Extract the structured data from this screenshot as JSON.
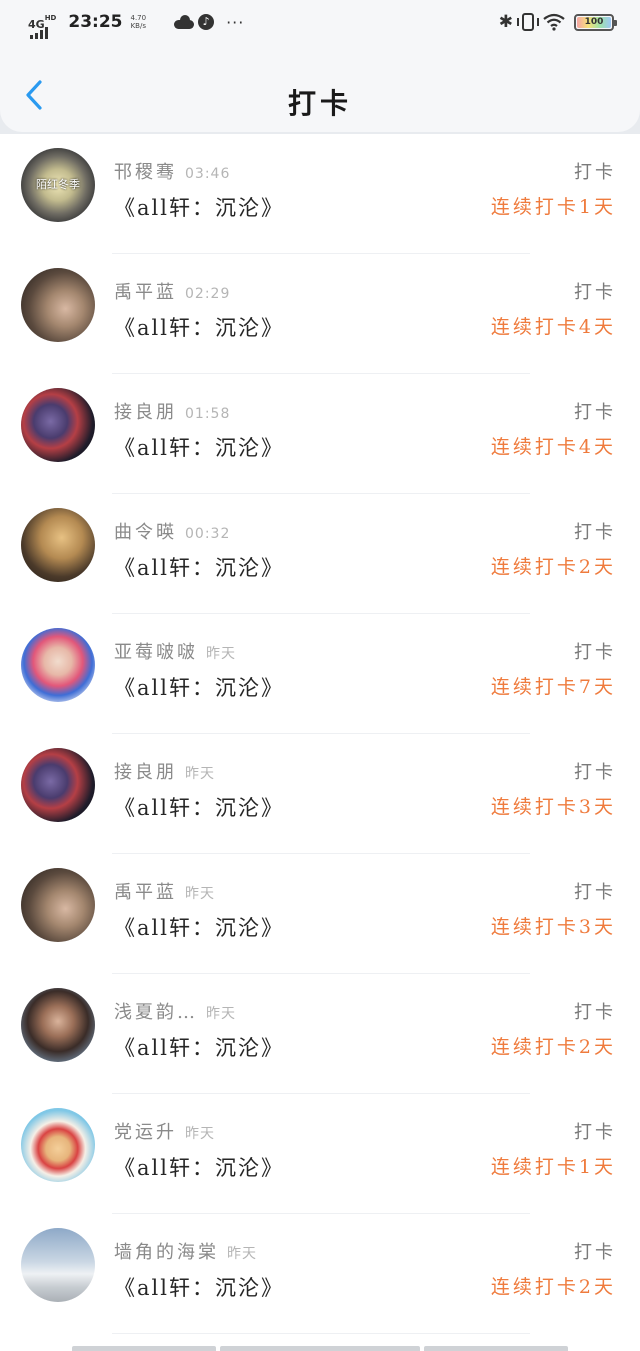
{
  "status_bar": {
    "network": "4G",
    "network_hd": "HD",
    "time": "23:25",
    "speed_value": "4.70",
    "speed_unit": "KB/s",
    "dots": "···",
    "battery": "100"
  },
  "header": {
    "title": "打卡"
  },
  "colors": {
    "streak": "#ef7b3d",
    "back_icon": "#2a9af0"
  },
  "entries": [
    {
      "name": "邗稷骞",
      "time": "03:46",
      "book": "《all轩：沉沦》",
      "action": "打卡",
      "streak": "连续打卡1天",
      "avatar": {
        "bg": "radial-gradient(circle at 50% 50%, #efe7b8 0%, #c2bb8e 30%, #6f6c63 55%, #2c2d30 80%)",
        "caption": "陌红冬季"
      }
    },
    {
      "name": "禹平蓝",
      "time": "02:29",
      "book": "《all轩：沉沦》",
      "action": "打卡",
      "streak": "连续打卡4天",
      "avatar": {
        "bg": "radial-gradient(circle at 60% 55%, #d8b8a3 0%, #a4876f 30%, #5b4a3e 60%, #2e2621 90%)",
        "caption": ""
      }
    },
    {
      "name": "接良朋",
      "time": "01:58",
      "book": "《all轩：沉沦》",
      "action": "打卡",
      "streak": "连续打卡4天",
      "avatar": {
        "bg": "radial-gradient(circle at 40% 45%, #7a6aa5 0%, #4a3c6e 28%, #b53f45 45%, #1f1c2a 70%, #0e0d14 90%)",
        "caption": ""
      }
    },
    {
      "name": "曲令暎",
      "time": "00:32",
      "book": "《all轩：沉沦》",
      "action": "打卡",
      "streak": "连续打卡2天",
      "avatar": {
        "bg": "radial-gradient(circle at 55% 40%, #e7c183 0%, #b48a52 35%, #4b3a2a 65%, #2a221b 90%)",
        "caption": ""
      }
    },
    {
      "name": "亚莓啵啵",
      "time": "昨天",
      "book": "《all轩：沉沦》",
      "action": "打卡",
      "streak": "连续打卡7天",
      "avatar": {
        "bg": "radial-gradient(circle at 50% 45%, #f1dccd 0%, #e7b8a8 25%, #e2577a 45%, #3e6dd6 62%, #f4f4f6 85%)",
        "caption": ""
      }
    },
    {
      "name": "接良朋",
      "time": "昨天",
      "book": "《all轩：沉沦》",
      "action": "打卡",
      "streak": "连续打卡3天",
      "avatar": {
        "bg": "radial-gradient(circle at 40% 45%, #7a6aa5 0%, #4a3c6e 28%, #b53f45 45%, #1f1c2a 70%, #0e0d14 90%)",
        "caption": ""
      }
    },
    {
      "name": "禹平蓝",
      "time": "昨天",
      "book": "《all轩：沉沦》",
      "action": "打卡",
      "streak": "连续打卡3天",
      "avatar": {
        "bg": "radial-gradient(circle at 60% 55%, #d8b8a3 0%, #a4876f 30%, #5b4a3e 60%, #2e2621 90%)",
        "caption": ""
      }
    },
    {
      "name": "浅夏韵…",
      "time": "昨天",
      "book": "《all轩：沉沦》",
      "action": "打卡",
      "streak": "连续打卡2天",
      "avatar": {
        "bg": "radial-gradient(circle at 50% 45%, #d9b39b 0%, #9b6f58 28%, #3a2c28 55%, #6b7e92 80%, #9fb0c0 95%)",
        "caption": ""
      }
    },
    {
      "name": "党运升",
      "time": "昨天",
      "book": "《all轩：沉沦》",
      "action": "打卡",
      "streak": "连续打卡1天",
      "avatar": {
        "bg": "radial-gradient(circle at 50% 55%, #f4cf9a 0%, #e7b57c 22%, #d94343 36%, #f6efe6 50%, #7fc7e6 70%, #8fd0ec 95%)",
        "caption": ""
      }
    },
    {
      "name": "墙角的海棠",
      "time": "昨天",
      "book": "《all轩：沉沦》",
      "action": "打卡",
      "streak": "连续打卡2天",
      "avatar": {
        "bg": "linear-gradient(180deg, #8ea9c8 0%, #c9d6e3 45%, #eef1f4 62%, #c7ccd1 80%, #aab0b6 100%)",
        "caption": ""
      }
    }
  ]
}
